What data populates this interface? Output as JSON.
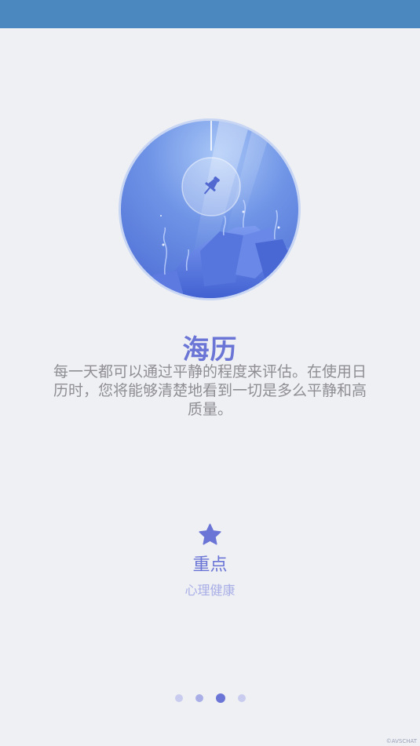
{
  "onboarding": {
    "title": "海历",
    "description": "每一天都可以通过平静的程度来评估。在使用日历时，您将能够清楚地看到一切是多么平静和高质量。",
    "feature": {
      "icon": "star-icon",
      "title": "重点",
      "subtitle": "心理健康"
    },
    "page_indicator": {
      "total": 4,
      "current": 3
    }
  },
  "watermark": "©AVSCHAT",
  "colors": {
    "status_bar": "#4a88bf",
    "background": "#eff0f4",
    "accent": "#6b75d6",
    "description_text": "#8e8e93",
    "subtitle_text": "#a8aee6"
  }
}
